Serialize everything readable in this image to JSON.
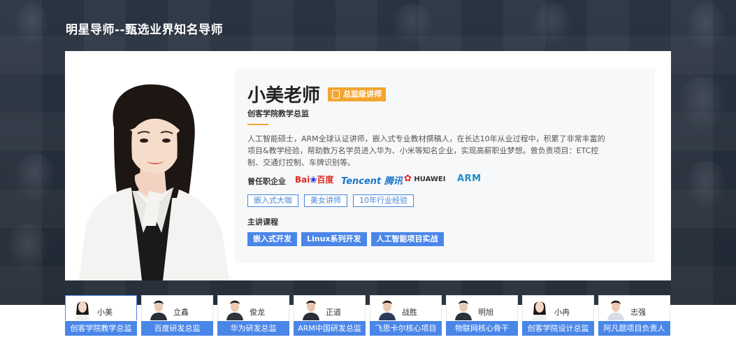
{
  "section_title": "明星导师--甄选业界知名导师",
  "featured": {
    "name": "小美老师",
    "badge": "总监级讲师",
    "subtitle": "创客学院教学总监",
    "description": "人工智能硕士，ARM全球认证讲师，嵌入式专业教材撰稿人，在长达10年从业过程中，积累了非常丰富的项目&教学经验，帮助数万名学员进入华为、小米等知名企业，实现高薪职业梦想。曾负责项目：ETC控制、交通灯控制、车牌识别等。",
    "company_label": "曾任职企业",
    "companies": {
      "baidu_a": "Bai",
      "baidu_b": "百度",
      "tencent_a": "Tencent",
      "tencent_b": "腾讯",
      "huawei": "HUAWEI",
      "arm": "ARM"
    },
    "tags": [
      "嵌入式大咖",
      "美女讲师",
      "10年行业经验"
    ],
    "course_label": "主讲课程",
    "courses": [
      "嵌入式开发",
      "Linux系列开发",
      "人工智能项目实战"
    ]
  },
  "mentors": [
    {
      "name": "小美",
      "role": "创客学院教学总监"
    },
    {
      "name": "立鑫",
      "role": "百度研发总监"
    },
    {
      "name": "俊龙",
      "role": "华为研发总监"
    },
    {
      "name": "正道",
      "role": "ARM中国研发总监"
    },
    {
      "name": "战胜",
      "role": "飞思卡尔核心项目"
    },
    {
      "name": "明旭",
      "role": "物联网核心骨干"
    },
    {
      "name": "小冉",
      "role": "创客学院设计总监"
    },
    {
      "name": "志强",
      "role": "阿凡题项目负责人"
    }
  ],
  "colors": {
    "accent_blue": "#4a86e8",
    "badge_orange": "#f2a52f",
    "dark_bg": "#232c37"
  }
}
